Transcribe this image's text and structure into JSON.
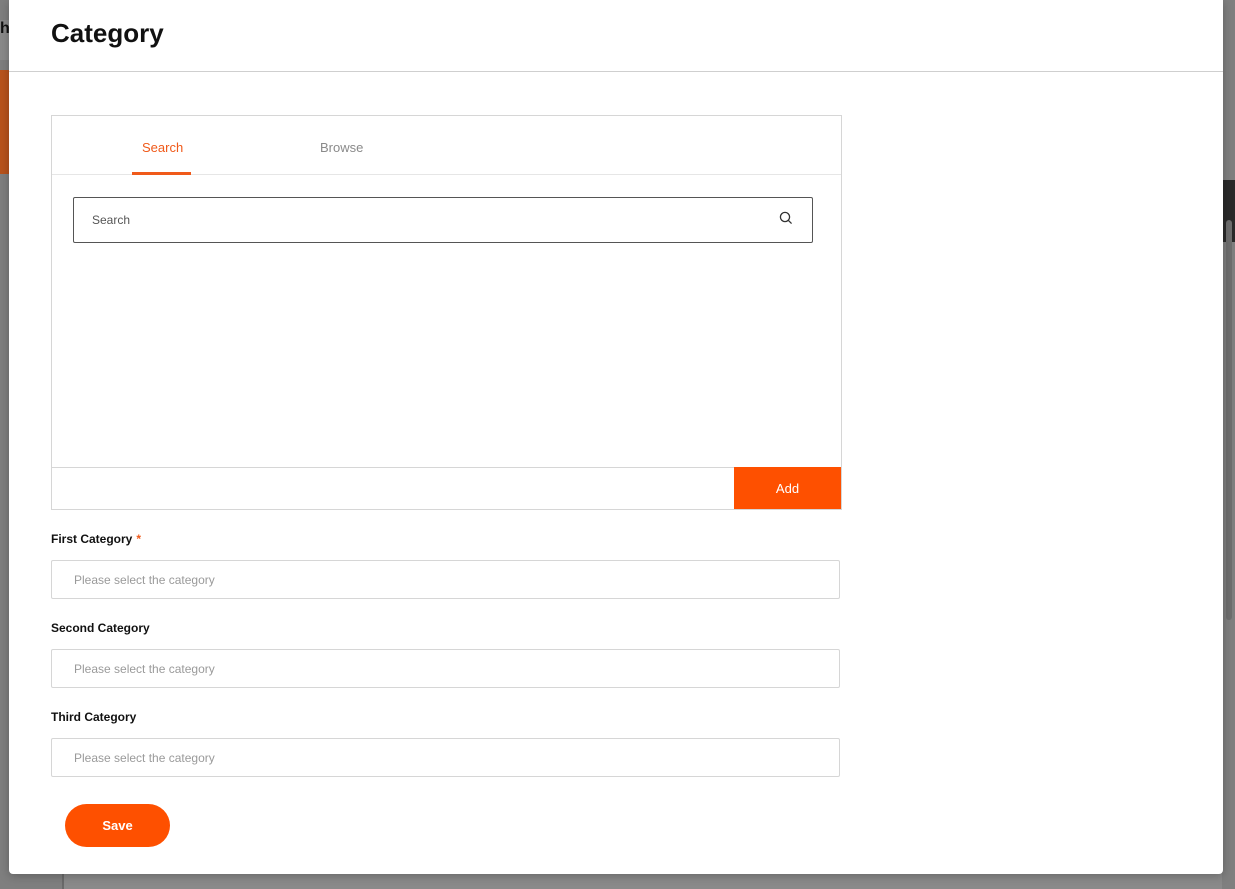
{
  "background": {
    "brand_fragment": "h"
  },
  "modal": {
    "title": "Category"
  },
  "picker": {
    "tabs": [
      {
        "label": "Search",
        "active": true
      },
      {
        "label": "Browse",
        "active": false
      }
    ],
    "search": {
      "placeholder": "Search",
      "value": ""
    },
    "add_label": "Add"
  },
  "fields": [
    {
      "label": "First Category",
      "required": true,
      "required_mark": "*",
      "placeholder": "Please select the category"
    },
    {
      "label": "Second Category",
      "required": false,
      "placeholder": "Please select the category"
    },
    {
      "label": "Third Category",
      "required": false,
      "placeholder": "Please select the category"
    }
  ],
  "save_label": "Save",
  "colors": {
    "accent": "#fe5000",
    "tab_active": "#f05a1a"
  },
  "icons": {
    "search": "search-icon"
  }
}
